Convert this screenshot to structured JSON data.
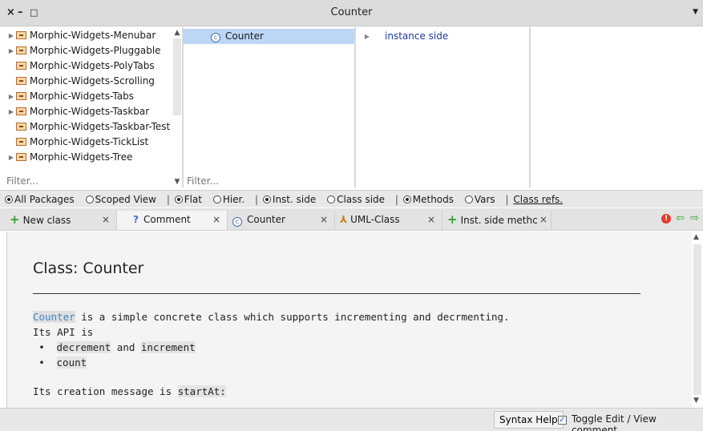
{
  "window": {
    "title": "Counter",
    "close_glyph": "×",
    "minimize_glyph": "–",
    "maximize_glyph": "□",
    "menu_glyph": "▼"
  },
  "packages": {
    "items": [
      {
        "label": "Morphic-Widgets-Menubar",
        "expandable": true
      },
      {
        "label": "Morphic-Widgets-Pluggable",
        "expandable": true
      },
      {
        "label": "Morphic-Widgets-PolyTabs",
        "expandable": false
      },
      {
        "label": "Morphic-Widgets-Scrolling",
        "expandable": false
      },
      {
        "label": "Morphic-Widgets-Tabs",
        "expandable": true
      },
      {
        "label": "Morphic-Widgets-Taskbar",
        "expandable": true
      },
      {
        "label": "Morphic-Widgets-Taskbar-Tests",
        "expandable": false
      },
      {
        "label": "Morphic-Widgets-TickList",
        "expandable": false
      },
      {
        "label": "Morphic-Widgets-Tree",
        "expandable": true
      }
    ],
    "filter_placeholder": "Filter..."
  },
  "classes": {
    "selected": "Counter",
    "icon_letter": "c",
    "filter_placeholder": "Filter..."
  },
  "protocols": {
    "item": "instance side"
  },
  "options": {
    "all_packages": "All Packages",
    "scoped_view": "Scoped View",
    "flat": "Flat",
    "hier": "Hier.",
    "inst_side": "Inst. side",
    "class_side": "Class side",
    "methods": "Methods",
    "vars": "Vars",
    "class_refs": "Class refs.",
    "separator": "|"
  },
  "tabs": [
    {
      "label": "New class",
      "icon": "plus-icon"
    },
    {
      "label": "Comment",
      "icon": "question-icon"
    },
    {
      "label": "Counter",
      "icon": "class-icon"
    },
    {
      "label": "UML-Class",
      "icon": "uml-icon"
    },
    {
      "label": "Inst. side methc",
      "icon": "plus-icon"
    }
  ],
  "tab_close_glyph": "×",
  "comment": {
    "heading": "Class: Counter",
    "line1_ref": "Counter",
    "line1_rest": " is a simple concrete class which supports incrementing and decrmenting.",
    "line2": "Its API is",
    "bullet_glyph": "•",
    "bullet1_a": "decrement",
    "bullet1_mid": " and ",
    "bullet1_b": "increment",
    "bullet2": "count",
    "line3_pre": "Its creation message is ",
    "line3_code": "startAt:"
  },
  "bottom": {
    "syntax_help": "Syntax Help",
    "toggle_label": "Toggle Edit / View comment",
    "toggle_checked": true
  },
  "colors": {
    "selection": "#bcd6f5",
    "link_blue": "#3b86c6",
    "add_green": "#2e9e2e",
    "warning_red": "#e03b2c"
  }
}
